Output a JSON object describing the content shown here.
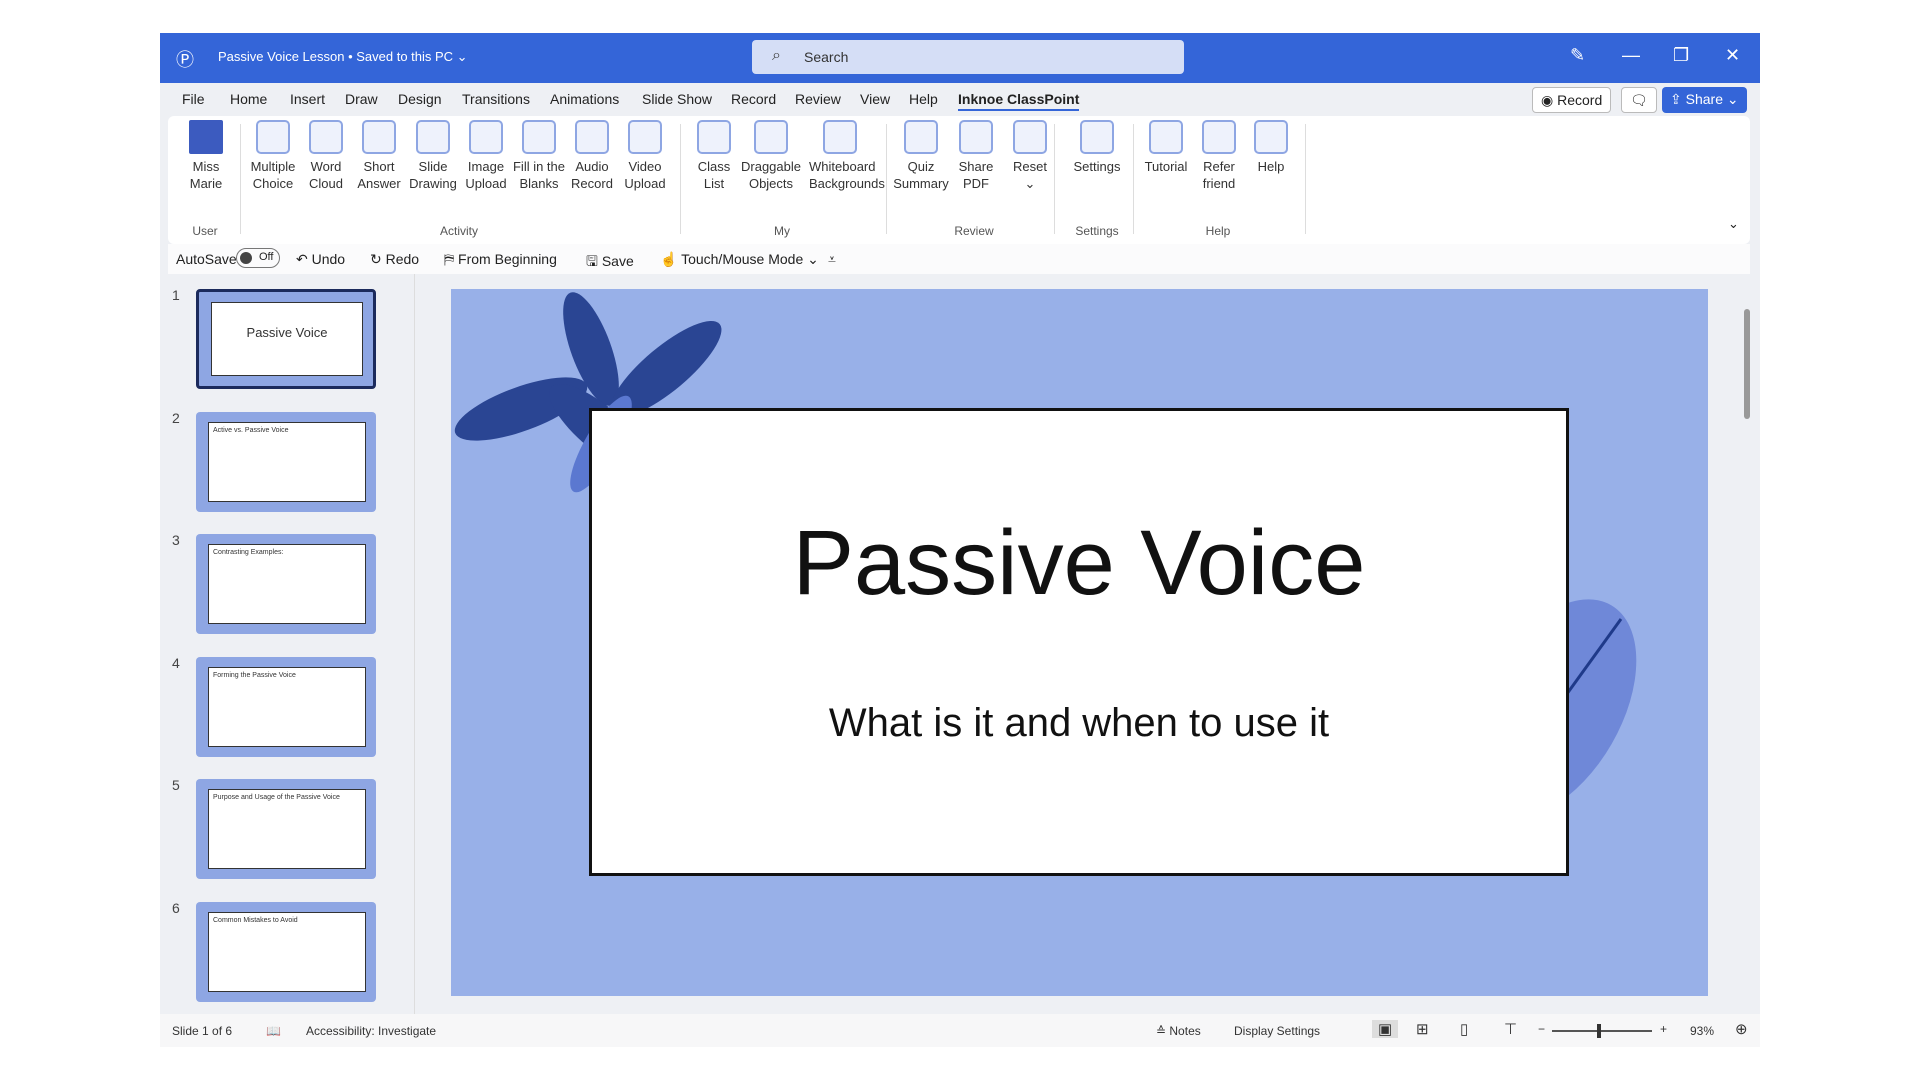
{
  "titlebar": {
    "title": "Passive Voice Lesson • Saved to this PC ⌄",
    "search_placeholder": "Search",
    "pen": "✎",
    "min": "—",
    "restore": "❐",
    "close": "✕"
  },
  "menu": {
    "tabs": [
      "File",
      "Home",
      "Insert",
      "Draw",
      "Design",
      "Transitions",
      "Animations",
      "Slide Show",
      "Record",
      "Review",
      "View",
      "Help",
      "Inknoe ClassPoint"
    ],
    "record": "◉ Record",
    "comment": "🗨",
    "share": "⇪ Share ⌄"
  },
  "ribbon": {
    "buttons": [
      "Miss\nMarie",
      "Multiple\nChoice",
      "Word\nCloud",
      "Short\nAnswer",
      "Slide\nDrawing",
      "Image\nUpload",
      "Fill in the\nBlanks",
      "Audio\nRecord",
      "Video\nUpload",
      "Class\nList",
      "Draggable\nObjects",
      "Whiteboard\nBackgrounds",
      "Quiz\nSummary",
      "Share\nPDF",
      "Reset\n⌄",
      "Settings",
      "Tutorial",
      "Refer\nfriend",
      "Help"
    ],
    "groups": [
      "User",
      "Activity",
      "My",
      "Review",
      "Settings",
      "Help"
    ],
    "collapse": "⌄"
  },
  "qat": {
    "autosave": "AutoSave",
    "toggle": "Off",
    "undo": "↶ Undo",
    "redo": "↻ Redo",
    "from_beginning": "⛿ From Beginning",
    "save": "🖫 Save",
    "touch": "☝ Touch/Mouse Mode ⌄",
    "more": "⩡"
  },
  "thumbs": [
    {
      "n": "1",
      "t": "Passive Voice"
    },
    {
      "n": "2",
      "t": "Active vs. Passive Voice"
    },
    {
      "n": "3",
      "t": "Contrasting Examples:"
    },
    {
      "n": "4",
      "t": "Forming the Passive Voice"
    },
    {
      "n": "5",
      "t": "Purpose and Usage of the Passive Voice"
    },
    {
      "n": "6",
      "t": "Common Mistakes to Avoid"
    }
  ],
  "slide": {
    "title": "Passive Voice",
    "subtitle": "What is it and when to use it"
  },
  "status": {
    "slide": "Slide 1 of 6",
    "accessibility": "Accessibility: Investigate",
    "notes": "≙ Notes",
    "display": "Display Settings",
    "zoom": "93%",
    "zoom_level": 93
  },
  "colors": {
    "accent": "#3465d8",
    "slide_bg": "#98b0e8",
    "leaf": "#1f3a8a"
  }
}
